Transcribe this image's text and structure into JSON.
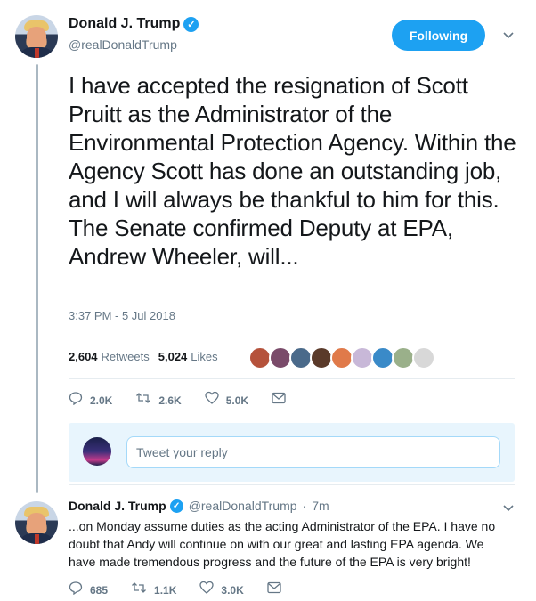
{
  "tweet": {
    "display_name": "Donald J. Trump",
    "handle": "@realDonaldTrump",
    "follow_label": "Following",
    "text": "I have accepted the resignation of Scott Pruitt as the Administrator of the Environmental Protection Agency. Within the Agency Scott has done an outstanding job, and I will always be thankful to him for this. The Senate confirmed Deputy at EPA, Andrew Wheeler, will...",
    "timestamp": "3:37 PM - 5 Jul 2018",
    "retweets_count": "2,604",
    "retweets_label": "Retweets",
    "likes_count": "5,024",
    "likes_label": "Likes",
    "actions": {
      "reply_count": "2.0K",
      "retweet_count": "2.6K",
      "like_count": "5.0K"
    }
  },
  "likers": [
    {
      "color": "#b5523b"
    },
    {
      "color": "#7a4b6a"
    },
    {
      "color": "#4a6a8a"
    },
    {
      "color": "#5a3a2a"
    },
    {
      "color": "#e07a4a"
    },
    {
      "color": "#c8b8d8"
    },
    {
      "color": "#3a8ac8"
    },
    {
      "color": "#9ab08a"
    },
    {
      "color": "#d8d8d8"
    }
  ],
  "reply": {
    "placeholder": "Tweet your reply"
  },
  "reply_tweet": {
    "display_name": "Donald J. Trump",
    "handle": "@realDonaldTrump",
    "separator": "·",
    "time_ago": "7m",
    "text": "...on Monday assume duties as the acting Administrator of the EPA. I have no doubt that Andy will continue on with our great and lasting EPA agenda. We have made tremendous progress and the future of the EPA is very bright!",
    "actions": {
      "reply_count": "685",
      "retweet_count": "1.1K",
      "like_count": "3.0K"
    }
  },
  "colors": {
    "accent": "#1da1f2",
    "secondary_text": "#657786",
    "reply_box_bg": "#e8f5fd"
  }
}
